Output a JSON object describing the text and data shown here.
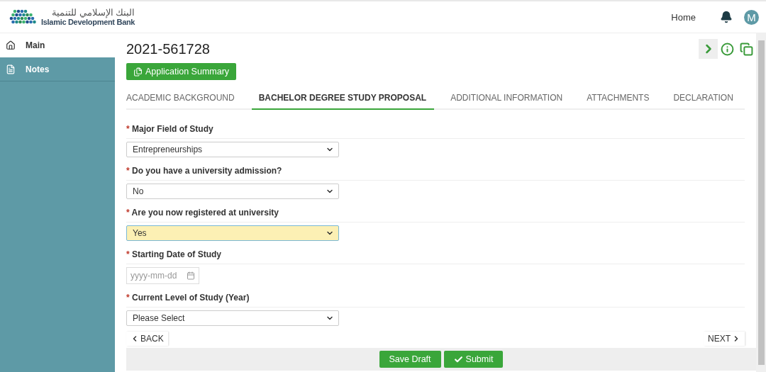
{
  "header": {
    "logo_arabic": "البنك الإسلامي للتنمية",
    "logo_english": "Islamic Development Bank",
    "nav_link": "Home",
    "avatar": "M"
  },
  "sidebar": {
    "items": [
      {
        "label": "Main",
        "selected": true
      },
      {
        "label": "Notes",
        "selected": false
      }
    ]
  },
  "page": {
    "title": "2021-561728",
    "summary_button": "Application Summary"
  },
  "tabs": [
    {
      "label": "ACADEMIC BACKGROUND",
      "selected": false
    },
    {
      "label": "BACHELOR DEGREE STUDY PROPOSAL",
      "selected": true
    },
    {
      "label": "ADDITIONAL INFORMATION",
      "selected": false
    },
    {
      "label": "ATTACHMENTS",
      "selected": false
    },
    {
      "label": "DECLARATION",
      "selected": false
    }
  ],
  "fields": [
    {
      "label": "Major Field of Study",
      "required_mark": "*",
      "kind": "select",
      "value": "Entrepreneurships",
      "highlighted": false
    },
    {
      "label": "Do you have a university admission?",
      "required_mark": "*",
      "kind": "select",
      "value": "No",
      "highlighted": false
    },
    {
      "label": "Are you now registered at university",
      "required_mark": "*",
      "kind": "select",
      "value": "Yes",
      "highlighted": true
    },
    {
      "label": "Starting Date of Study",
      "required_mark": "*",
      "kind": "date",
      "placeholder": "yyyy-mm-dd"
    },
    {
      "label": "Current Level of Study (Year)",
      "required_mark": "*",
      "kind": "select",
      "value": "Please Select",
      "highlighted": false
    }
  ],
  "pager": {
    "back": "BACK",
    "next": "NEXT"
  },
  "actions": [
    {
      "label": "Save Draft",
      "kind": "plain"
    },
    {
      "label": "Submit",
      "kind": "check"
    }
  ]
}
